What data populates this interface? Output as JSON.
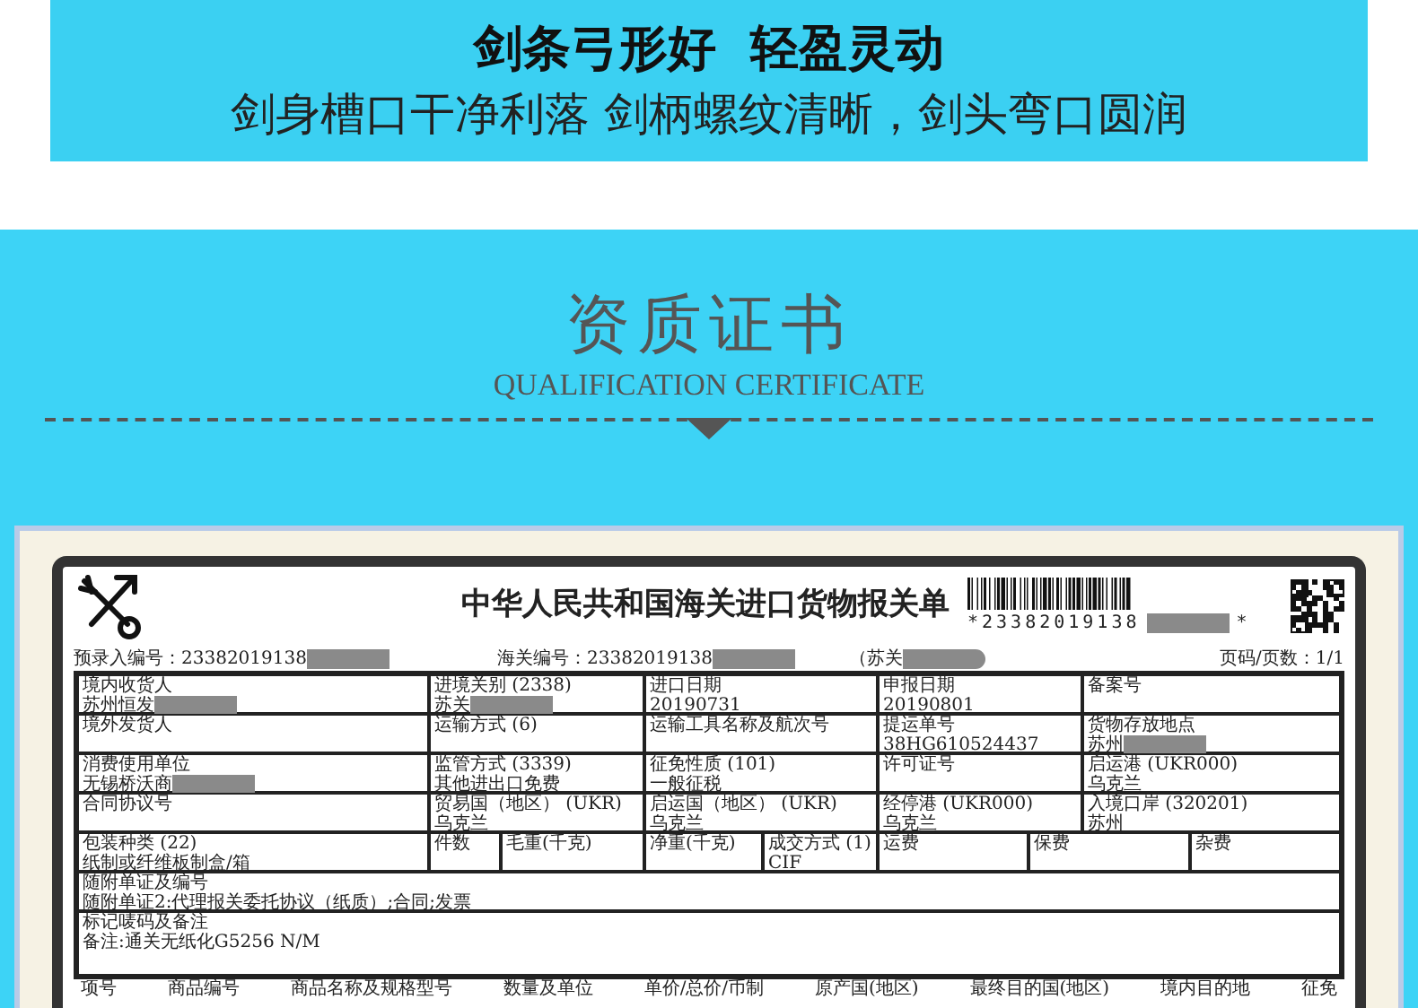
{
  "banner": {
    "title": "剑条弓形好  轻盈灵动",
    "subtitle": "剑身槽口干净利落 剑柄螺纹清晰，剑头弯口圆润"
  },
  "section": {
    "title": "资质证书",
    "subtitle": "QUALIFICATION CERTIFICATE"
  },
  "document": {
    "title": "中华人民共和国海关进口货物报关单",
    "barcode_text": "*23382019138",
    "barcode_end": "*",
    "barcode_redacted": true,
    "pre_entry": {
      "label": "预录入编号：",
      "value": "23382019138",
      "redacted": true
    },
    "customs_no": {
      "label": "海关编号：",
      "value": "23382019138",
      "redacted": true
    },
    "office": {
      "value": "（苏关",
      "redacted": true
    },
    "page": "页码/页数：1/1",
    "rows": [
      [
        {
          "label": "境内收货人",
          "value": "苏州恒发",
          "redacted": true
        },
        {
          "label": "进境关别 (2338)",
          "value": "苏关",
          "redacted": true
        },
        {
          "label": "进口日期",
          "value": "20190731",
          "redacted": false
        },
        {
          "label": "申报日期",
          "value": "20190801",
          "redacted": false
        },
        {
          "label": "备案号",
          "redacted": false
        }
      ],
      [
        {
          "label": "境外发货人",
          "redacted": false
        },
        {
          "label": "运输方式 (6)",
          "redacted": false
        },
        {
          "label": "运输工具名称及航次号",
          "redacted": false
        },
        {
          "label": "提运单号",
          "value": "38HG610524437",
          "redacted": false
        },
        {
          "label": "货物存放地点",
          "value": "苏州",
          "redacted": true
        }
      ],
      [
        {
          "label": "消费使用单位",
          "value": "无锡桥沃商",
          "redacted": true
        },
        {
          "label": "监管方式 (3339)",
          "value": "其他进出口免费",
          "redacted": false
        },
        {
          "label": "征免性质 (101)",
          "value": "一般征税",
          "redacted": false
        },
        {
          "label": "许可证号",
          "redacted": false
        },
        {
          "label": "启运港 (UKR000)",
          "value": "乌克兰",
          "redacted": false
        }
      ],
      [
        {
          "label": "合同协议号",
          "redacted": false
        },
        {
          "label": "贸易国（地区） (UKR)",
          "value": "乌克兰",
          "redacted": false
        },
        {
          "label": "启运国（地区） (UKR)",
          "value": "乌克兰",
          "redacted": false
        },
        {
          "label": "经停港 (UKR000)",
          "value": "乌克兰",
          "redacted": false
        },
        {
          "label": "入境口岸 (320201)",
          "value": "苏州",
          "redacted": false
        }
      ]
    ],
    "package_row": [
      {
        "label": "包装种类 (22)",
        "value": "纸制或纤维板制盒/箱"
      },
      {
        "label": "件数"
      },
      {
        "label": "毛重(千克)"
      },
      {
        "label": "净重(千克)"
      },
      {
        "label": "成交方式 (1)",
        "value": "CIF"
      },
      {
        "label": "运费"
      },
      {
        "label": "保费"
      },
      {
        "label": "杂费"
      }
    ],
    "notes": [
      {
        "label": "随附单证及编号",
        "value": "随附单证2:代理报关委托协议（纸质）;合同;发票"
      },
      {
        "label": "标记唛码及备注",
        "value": "备注:通关无纸化G5256 N/M"
      }
    ],
    "goods_header": [
      "项号",
      "商品编号",
      "商品名称及规格型号",
      "数量及单位",
      "单价/总价/币制",
      "原产国(地区)",
      "最终目的国(地区)",
      "境内目的地",
      "征免"
    ]
  }
}
